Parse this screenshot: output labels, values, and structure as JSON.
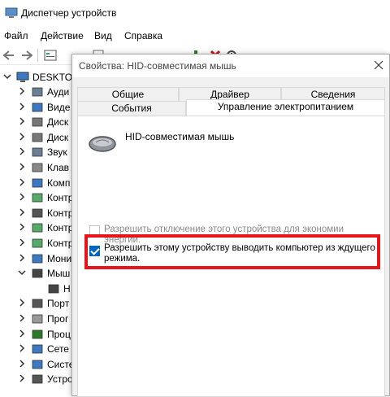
{
  "window": {
    "title": "Диспетчер устройств"
  },
  "menu": [
    "Файл",
    "Действие",
    "Вид",
    "Справка"
  ],
  "toolbar": {
    "icons": [
      "back-arrow-icon",
      "forward-arrow-icon",
      "properties-icon",
      "help-icon",
      "update-driver-icon",
      "monitor-icon",
      "enable-device-icon",
      "uninstall-icon",
      "scan-hardware-icon"
    ]
  },
  "tree": {
    "root_label": "DESKTOP",
    "items": [
      {
        "label": "Ауди",
        "icon": "audio-icon"
      },
      {
        "label": "Виде",
        "icon": "video-icon"
      },
      {
        "label": "Диск",
        "icon": "disk-icon"
      },
      {
        "label": "Диск",
        "icon": "disk-drive-icon"
      },
      {
        "label": "Звук",
        "icon": "sound-icon"
      },
      {
        "label": "Клав",
        "icon": "keyboard-icon"
      },
      {
        "label": "Комп",
        "icon": "computer-icon"
      },
      {
        "label": "Контр",
        "icon": "controller-icon"
      },
      {
        "label": "Контр",
        "icon": "usb-controller-icon"
      },
      {
        "label": "Контр",
        "icon": "controller-icon"
      },
      {
        "label": "Контр",
        "icon": "controller-icon"
      },
      {
        "label": "Мони",
        "icon": "monitor-icon"
      },
      {
        "label": "Мыш",
        "icon": "mouse-icon"
      },
      {
        "label": "Н",
        "icon": "mouse-icon"
      },
      {
        "label": "Порт",
        "icon": "port-icon"
      },
      {
        "label": "Прог",
        "icon": "software-icon"
      },
      {
        "label": "Проц",
        "icon": "processor-icon"
      },
      {
        "label": "Сете",
        "icon": "network-icon"
      },
      {
        "label": "Систе",
        "icon": "system-icon"
      },
      {
        "label": "Устро",
        "icon": "usb-icon"
      }
    ]
  },
  "dialog": {
    "title": "Свойства: HID-совместимая мышь",
    "tabs_back": [
      "Общие",
      "Драйвер",
      "Сведения"
    ],
    "tabs_front": [
      "События",
      "Управление электропитанием"
    ],
    "active_tab": "Управление электропитанием",
    "device_name": "HID-совместимая мышь",
    "option_power_off": {
      "label": "Разрешить отключение этого устройства для экономии энергии.",
      "checked": false,
      "enabled": false
    },
    "option_wake": {
      "label_line1": "Разрешить этому устройству выводить компьютер из ждущего",
      "label_line2": "режима.",
      "checked": true,
      "enabled": true
    },
    "highlight_color": "#e8141a"
  }
}
